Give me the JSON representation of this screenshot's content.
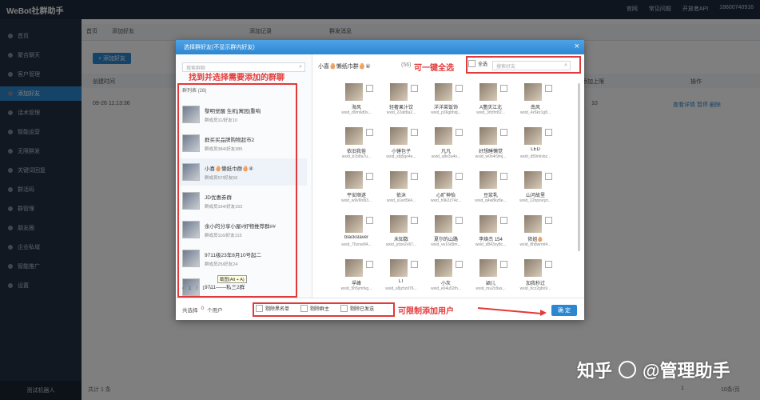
{
  "app": {
    "logo": "WeBot社群助手",
    "topbar_items": [
      "官网",
      "常见问题",
      "开放者API",
      "18600740916"
    ]
  },
  "sidebar": {
    "items": [
      "首页",
      "聚合聊天",
      "客户管理",
      "添加好友",
      "话术管理",
      "智能运营",
      "无限群发",
      "关键词回复",
      "群活码",
      "群管理",
      "朋友圈",
      "企业私域",
      "智能推广",
      "设置"
    ],
    "active_index": 3,
    "bottom": "测试机器人"
  },
  "background": {
    "tabs": [
      "首页",
      "添加好友",
      "添加记录",
      "群发消息"
    ],
    "add_button": "+ 添加好友",
    "table_headers": [
      "创建时间",
      "添加上限",
      "操作"
    ],
    "row": {
      "time": "09-26 11:13:36",
      "limit": "10",
      "ops": "查看详情 暂停 删除"
    },
    "footer_total": "共计 1 条",
    "footer_page": "1",
    "footer_per": "10条/页"
  },
  "modal": {
    "title": "选择群好友(不显示群内好友)",
    "close": "×",
    "search_placeholder": "搜索群聊",
    "group_count": "群列表 (28)",
    "groups": [
      {
        "name": "黎明觉醒 生机|寓园|重响",
        "sub": "群成员11/好友10"
      },
      {
        "name": "群买买品牌购物超市2",
        "sub": "群成员384/好友385"
      },
      {
        "name": "小喜🥚懒纸巾群🥚④",
        "sub": "群成员57/好友56"
      },
      {
        "name": "JD优惠券群",
        "sub": "群成员164/好友162"
      },
      {
        "name": "余小的分享小屋#好物推荐群##",
        "sub": "群成员116/好友115"
      },
      {
        "name": "9711级23年8月10号起二",
        "sub": "群成员25/好友24"
      },
      {
        "name": "9711——私三2群",
        "sub": ""
      }
    ],
    "tooltip": "截图(Alt + A)",
    "pager": {
      "prev": "‹",
      "current": "1",
      "sep": "/",
      "total": "1",
      "next": "›"
    },
    "right_title": "小喜🥚懒纸巾群🥚④",
    "right_count": "(56)",
    "select_all": "全选",
    "right_search_placeholder": "搜索好友",
    "members": [
      {
        "name": "海风",
        "id": "wxid_d9m6d9x..."
      },
      {
        "name": "轻奢果汁饮",
        "id": "wxid_22afdta2..."
      },
      {
        "name": "洋洋菜饭饰",
        "id": "wxid_p36gbhdj..."
      },
      {
        "name": "A董庆江北",
        "id": "wxid_3rfzfrr82..."
      },
      {
        "name": "南风",
        "id": "wxid_4z6kz1g8..."
      },
      {
        "name": "依旧我俗",
        "id": "wxid_b7p8a7u..."
      },
      {
        "name": "小锤包子",
        "id": "wxid_sbj5go4e..."
      },
      {
        "name": "凡凡",
        "id": "wxid_u8e3u4o..."
      },
      {
        "name": "好想睡懒觉",
        "id": "wxid_w0n4r9mj..."
      },
      {
        "name": "LED",
        "id": "wxid_d59mlxbz..."
      },
      {
        "name": "平安顺遂",
        "id": "wxid_w9v6h8i3..."
      },
      {
        "name": "依沐",
        "id": "wxid_s1ert5k4..."
      },
      {
        "name": "心旷神怡",
        "id": "wxid_h9k2z74z..."
      },
      {
        "name": "豆浆乳",
        "id": "wxid_q4w8kz8e..."
      },
      {
        "name": "山河故里",
        "id": "wxid_12npsvqzl..."
      },
      {
        "name": "blackslaver",
        "id": "wxid_76zrxe84..."
      },
      {
        "name": "未知数",
        "id": "wxid_jcton2v67..."
      },
      {
        "name": "夏尔的山路",
        "id": "wxid_ve16d9m..."
      },
      {
        "name": "李焕杰 154",
        "id": "wxid_d843zy8c..."
      },
      {
        "name": "侬姐🥚",
        "id": "wxid_8h8wrmt4..."
      },
      {
        "name": "孚峰",
        "id": "wxid_5h5ymfvg..."
      },
      {
        "name": "LT",
        "id": "wxid_s8jzhzd76..."
      },
      {
        "name": "小灰",
        "id": "wxid_e04u52th..."
      },
      {
        "name": "颖儿",
        "id": "wxid_mu2c8ax..."
      },
      {
        "name": "加我秒过",
        "id": "wxid_hcz2gbn9..."
      }
    ],
    "footer": {
      "chosen_label": "共选择",
      "chosen_count": "0",
      "chosen_unit": "个用户",
      "options": [
        "剔除黑名单",
        "剔除群主",
        "剔除已发送"
      ],
      "confirm": "确 定"
    }
  },
  "annotations": {
    "group_hint": "找到并选择需要添加的群聊",
    "select_all_hint": "可一键全选",
    "limit_hint": "可限制添加用户",
    "color": "#e23a3a"
  },
  "watermark": {
    "brand": "知乎",
    "account": "@管理助手"
  }
}
